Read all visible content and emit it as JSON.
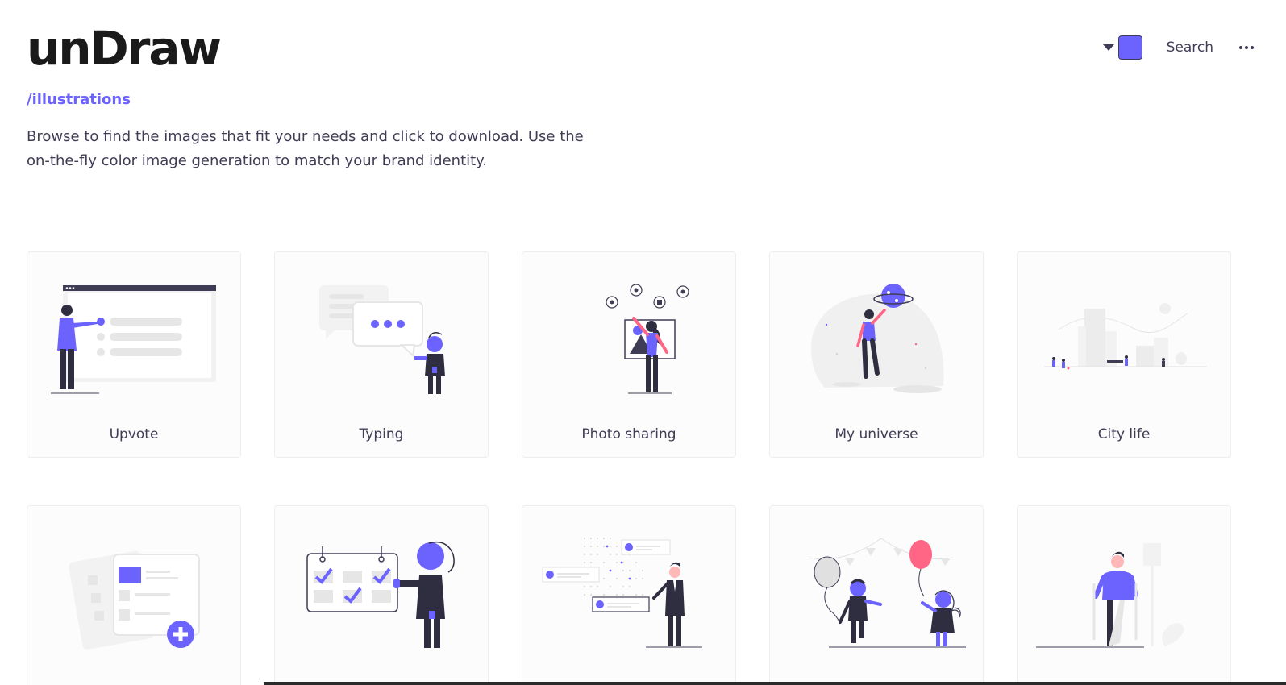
{
  "app": {
    "logo": "unDraw",
    "path": "/illustrations",
    "description": "Browse to find the images that fit your needs and click to download. Use the on-the-fly color image generation to match your brand identity."
  },
  "header": {
    "search_label": "Search",
    "color_picker_value": "#6c63ff"
  },
  "colors": {
    "accent": "#6c63ff",
    "dark": "#2f2e41",
    "light": "#e6e6e6",
    "pink": "#ff6584"
  },
  "illustrations": [
    {
      "title": "Upvote",
      "icon": "upvote-illustration"
    },
    {
      "title": "Typing",
      "icon": "typing-illustration"
    },
    {
      "title": "Photo sharing",
      "icon": "photo-sharing-illustration"
    },
    {
      "title": "My universe",
      "icon": "my-universe-illustration"
    },
    {
      "title": "City life",
      "icon": "city-life-illustration"
    },
    {
      "title": "",
      "icon": "add-document-illustration"
    },
    {
      "title": "",
      "icon": "calendar-illustration"
    },
    {
      "title": "",
      "icon": "timeline-illustration"
    },
    {
      "title": "",
      "icon": "balloons-illustration"
    },
    {
      "title": "",
      "icon": "injured-illustration"
    }
  ]
}
